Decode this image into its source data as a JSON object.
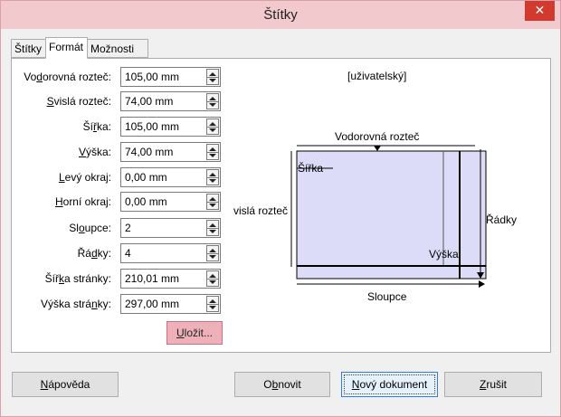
{
  "window": {
    "title": "Štítky",
    "close_glyph": "✕"
  },
  "tabs": [
    {
      "label": "Štítky"
    },
    {
      "label": "Formát"
    },
    {
      "label": "Možnosti"
    }
  ],
  "fields": [
    {
      "id": "horizontal-pitch",
      "pre": "Vo",
      "acc": "d",
      "post": "orovná rozteč:",
      "value": "105,00 mm"
    },
    {
      "id": "vertical-pitch",
      "pre": "",
      "acc": "S",
      "post": "vislá rozteč:",
      "value": "74,00 mm"
    },
    {
      "id": "width",
      "pre": "Ší",
      "acc": "ř",
      "post": "ka:",
      "value": "105,00 mm"
    },
    {
      "id": "height",
      "pre": "",
      "acc": "V",
      "post": "ýška:",
      "value": "74,00 mm"
    },
    {
      "id": "left-margin",
      "pre": "",
      "acc": "L",
      "post": "evý okraj:",
      "value": "0,00 mm"
    },
    {
      "id": "top-margin",
      "pre": "",
      "acc": "H",
      "post": "orní okraj:",
      "value": "0,00 mm"
    },
    {
      "id": "columns",
      "pre": "Sl",
      "acc": "o",
      "post": "upce:",
      "value": "2"
    },
    {
      "id": "rows",
      "pre": "Řá",
      "acc": "d",
      "post": "ky:",
      "value": "4"
    },
    {
      "id": "page-width",
      "pre": "Šíř",
      "acc": "k",
      "post": "a stránky:",
      "value": "210,01 mm"
    },
    {
      "id": "page-height",
      "pre": "Výška strá",
      "acc": "n",
      "post": "ky:",
      "value": "297,00 mm"
    }
  ],
  "save_button": {
    "acc": "U",
    "post": "ložit..."
  },
  "preview": {
    "preset": "[uživatelský]",
    "horizontal_pitch": "Vodorovná rozteč",
    "vertical_pitch": "vislá rozteč",
    "width": "Šířka",
    "height": "Výška",
    "rows": "Řádky",
    "columns": "Sloupce",
    "fill_color": "#dcdcf8"
  },
  "buttons": {
    "help": {
      "acc": "N",
      "post": "ápověda"
    },
    "reset": {
      "pre": "O",
      "acc": "b",
      "post": "novit"
    },
    "new_document": {
      "acc": "N",
      "post": "ový dokument"
    },
    "cancel": {
      "acc": "Z",
      "post": "rušit"
    }
  }
}
